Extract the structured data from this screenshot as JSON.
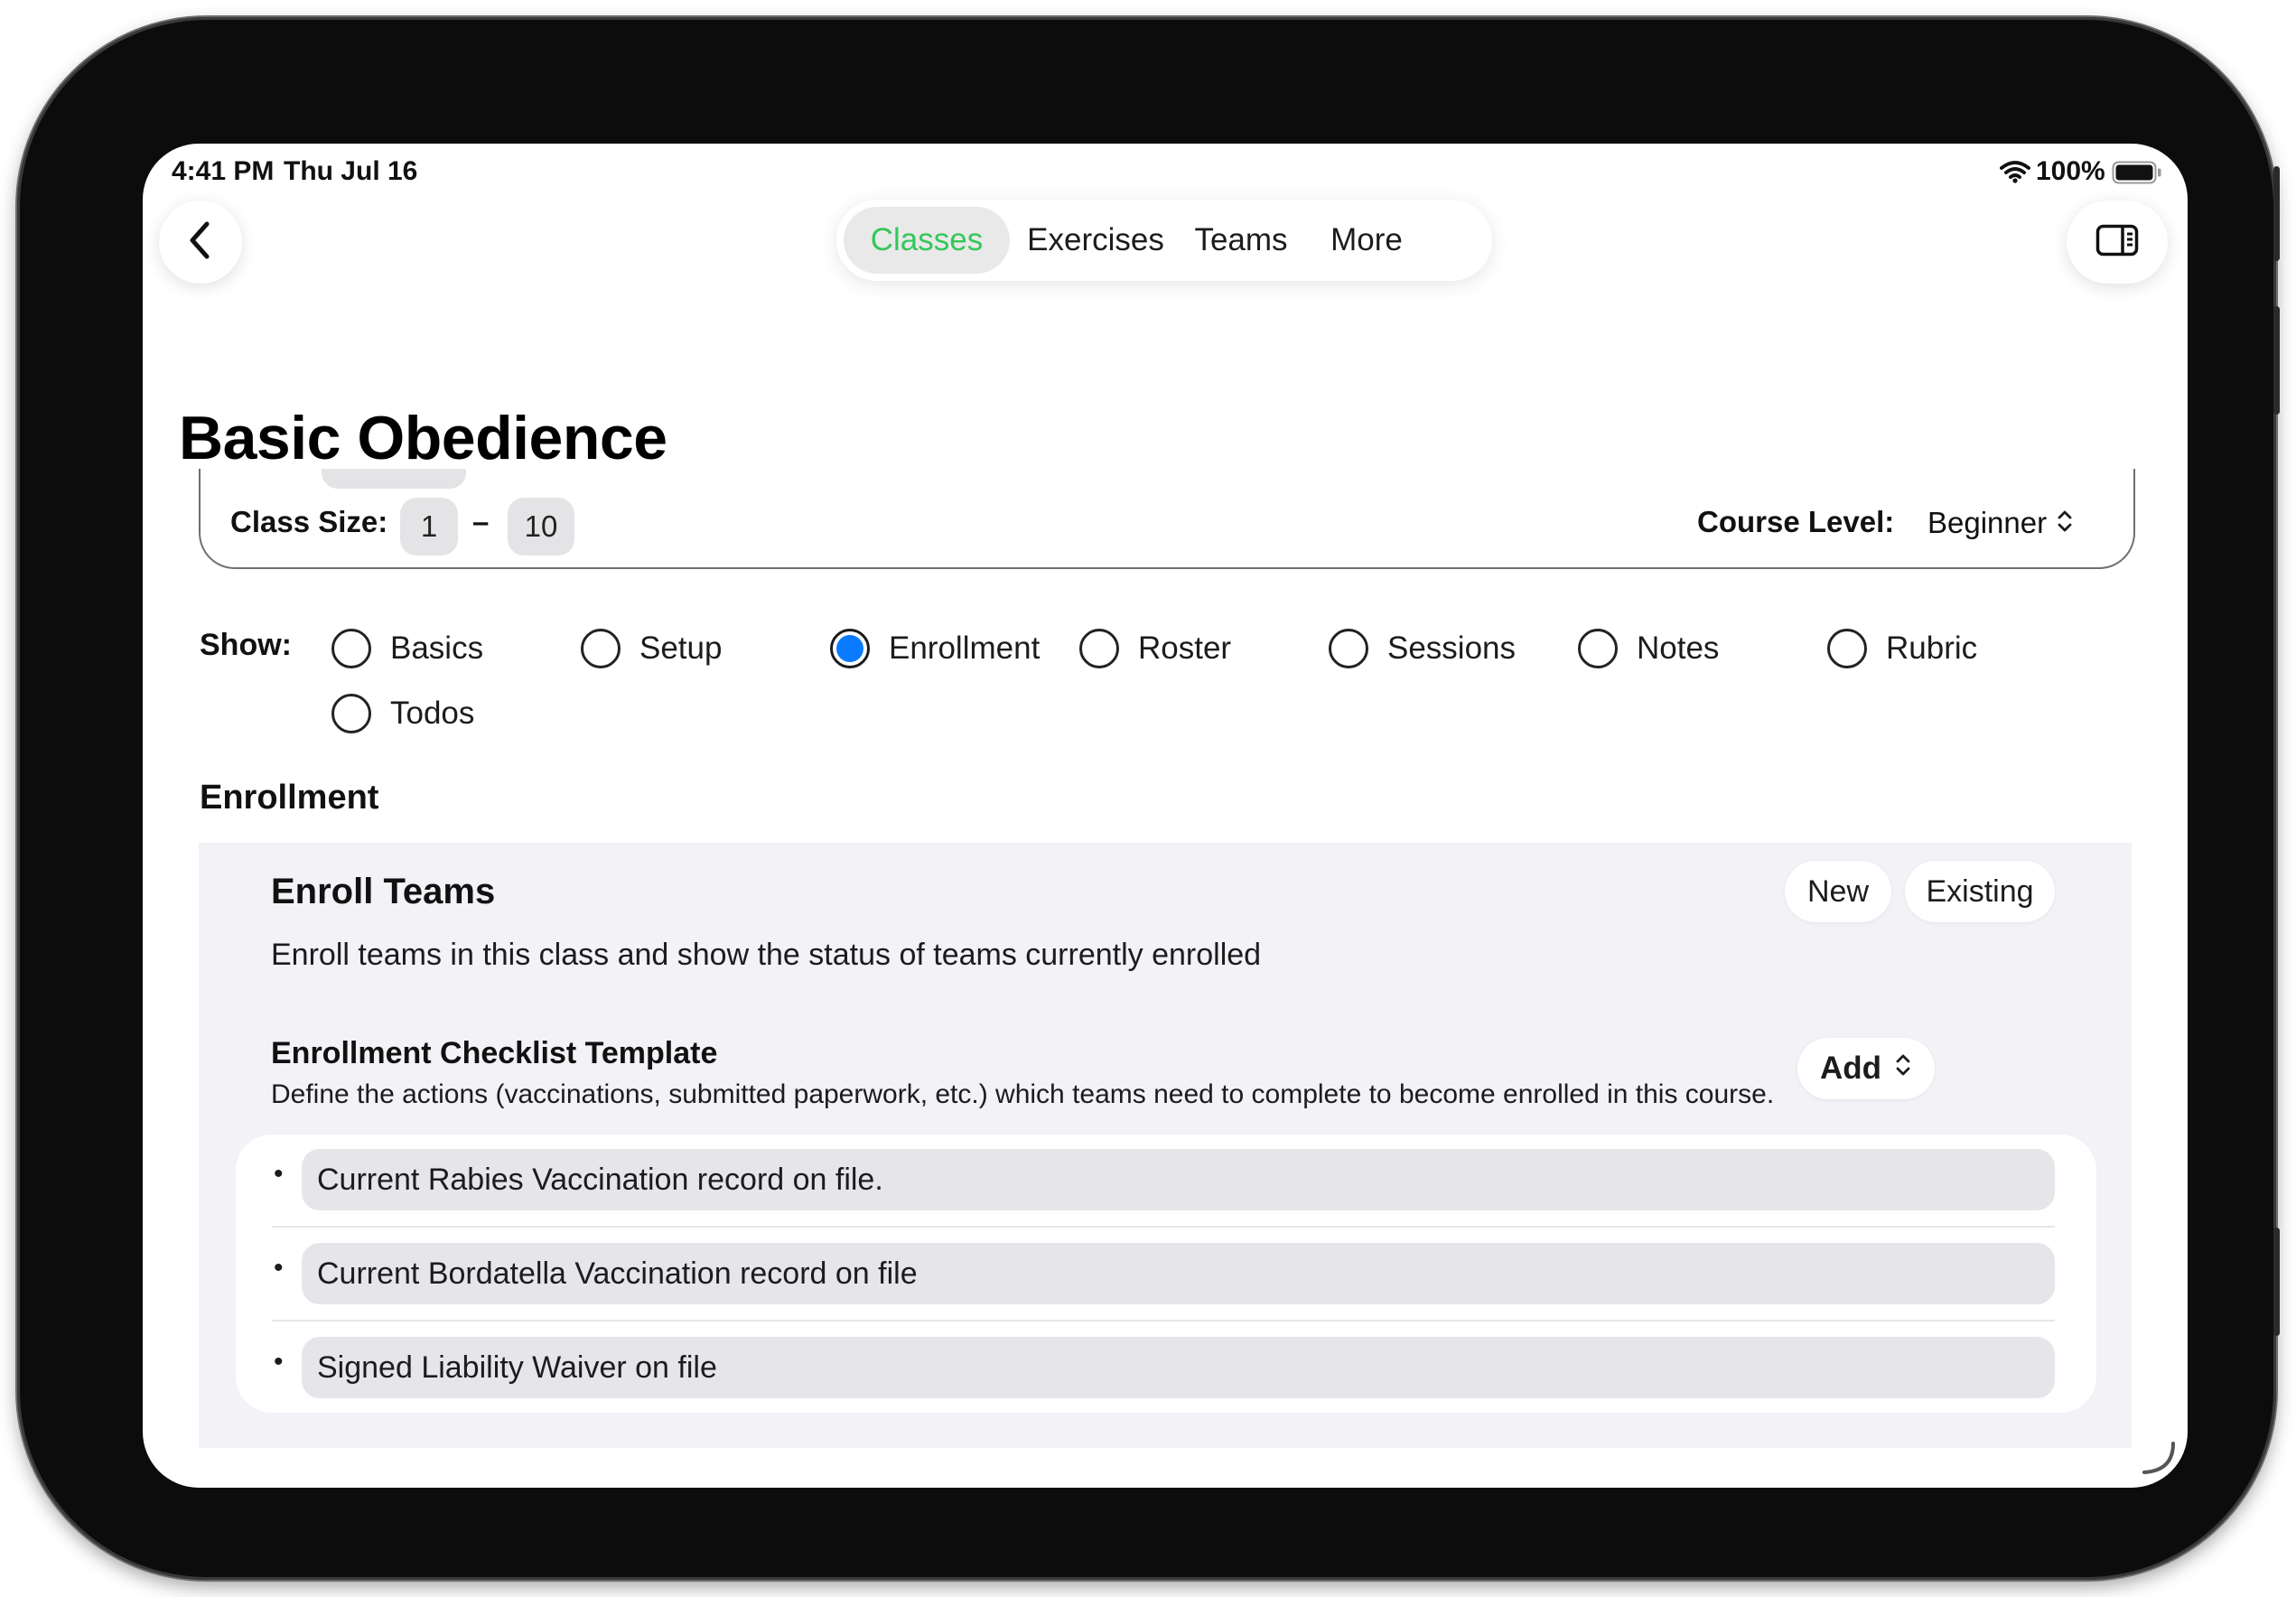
{
  "status_bar": {
    "time": "4:41 PM",
    "date": "Thu Jul 16",
    "battery": "100%",
    "icons": [
      "wifi-icon",
      "battery-icon"
    ]
  },
  "nav": {
    "back_icon": "chevron-left-icon",
    "sidebar_icon": "sidebar-toggle-icon",
    "tabs": [
      {
        "label": "Classes",
        "active": true
      },
      {
        "label": "Exercises",
        "active": false
      },
      {
        "label": "Teams",
        "active": false
      },
      {
        "label": "More",
        "active": false
      }
    ]
  },
  "page": {
    "title": "Basic Obedience"
  },
  "class_info": {
    "size_label": "Class Size:",
    "size_min": "1",
    "size_separator": "–",
    "size_max": "10",
    "level_label": "Course Level:",
    "level_value": "Beginner"
  },
  "show": {
    "label": "Show:",
    "options": [
      {
        "label": "Basics",
        "selected": false
      },
      {
        "label": "Setup",
        "selected": false
      },
      {
        "label": "Enrollment",
        "selected": true
      },
      {
        "label": "Roster",
        "selected": false
      },
      {
        "label": "Sessions",
        "selected": false
      },
      {
        "label": "Notes",
        "selected": false
      },
      {
        "label": "Rubric",
        "selected": false
      },
      {
        "label": "Todos",
        "selected": false
      }
    ]
  },
  "enrollment": {
    "section_title": "Enrollment",
    "enroll_title": "Enroll Teams",
    "enroll_desc": "Enroll teams in this class and show the status of teams currently enrolled",
    "new_label": "New",
    "existing_label": "Existing",
    "checklist_title": "Enrollment Checklist Template",
    "checklist_desc": "Define the actions (vaccinations, submitted paperwork, etc.) which teams need to complete to become enrolled in this course.",
    "add_label": "Add",
    "items": [
      "Current Rabies Vaccination record on file.",
      "Current Bordatella Vaccination record on file",
      "Signed Liability Waiver on file"
    ]
  },
  "colors": {
    "accent_green": "#34c759",
    "radio_blue": "#0a7bff",
    "panel_bg": "#f2f2f7"
  }
}
